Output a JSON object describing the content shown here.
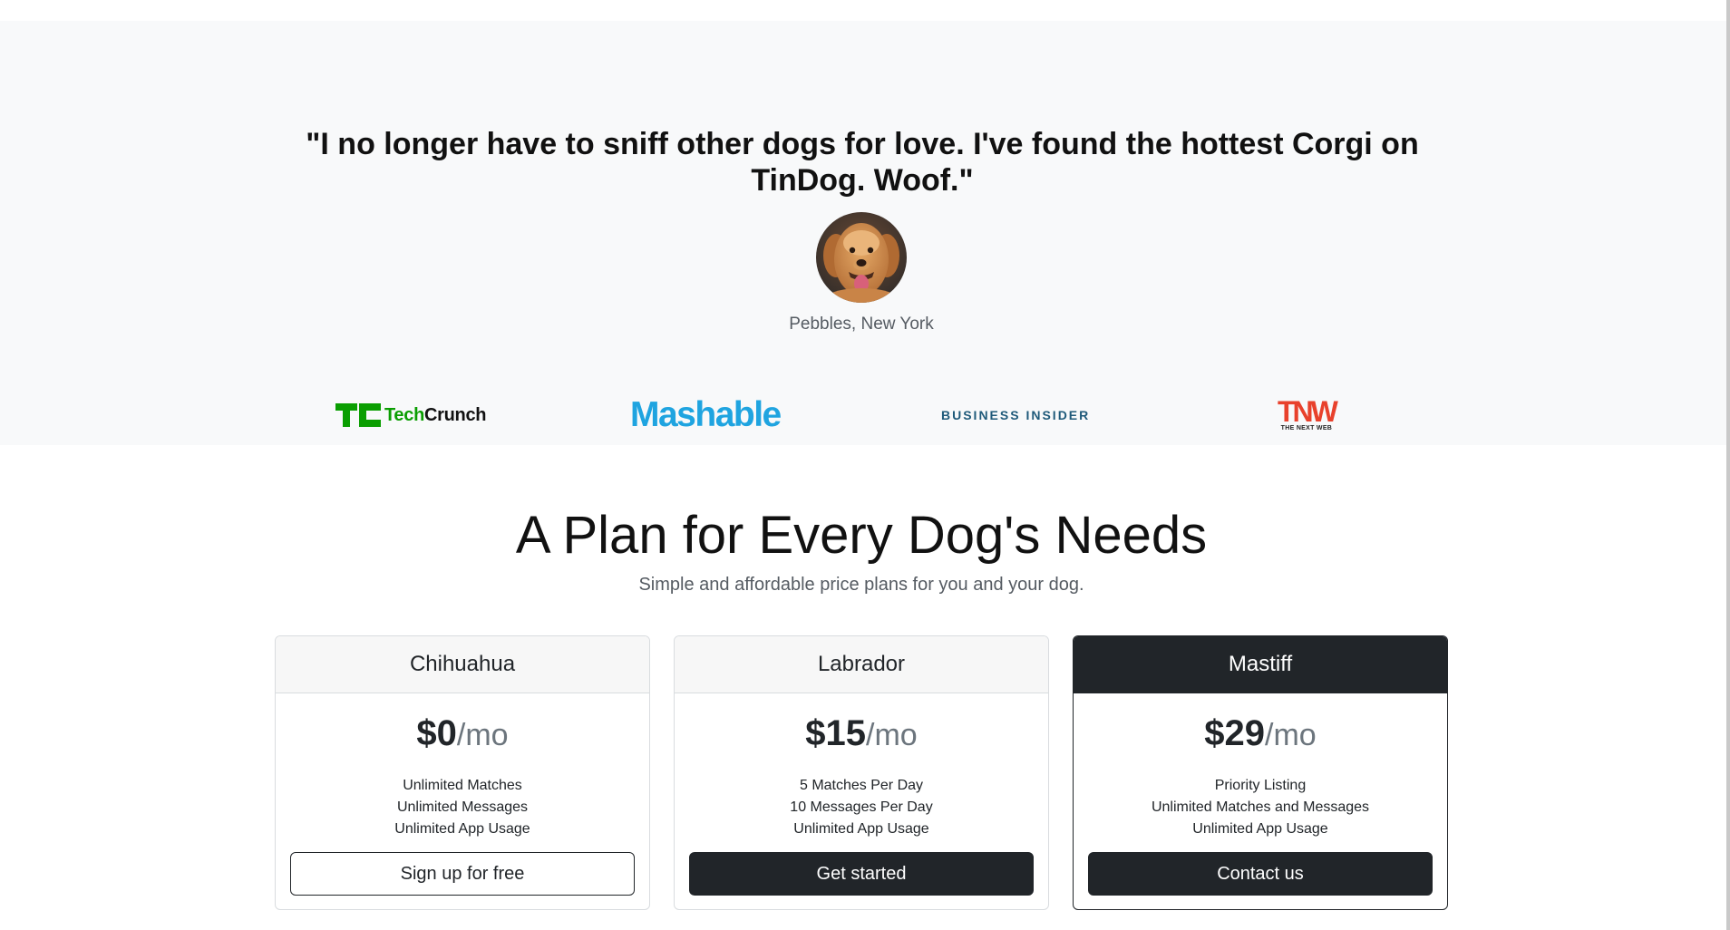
{
  "testimonial": {
    "quote": "\"I no longer have to sniff other dogs for love. I've found the hottest Corgi on TinDog. Woof.\"",
    "author": "Pebbles, New York",
    "avatar": "golden-retriever-photo"
  },
  "press": {
    "techcrunch": {
      "tech": "Tech",
      "crunch": "Crunch"
    },
    "mashable": "Mashable",
    "business_insider": "BUSINESS INSIDER",
    "tnw": {
      "mark": "TNW",
      "sub": "THE NEXT WEB"
    }
  },
  "pricing": {
    "title": "A Plan for Every Dog's Needs",
    "subtitle": "Simple and affordable price plans for you and your dog.",
    "plans": [
      {
        "name": "Chihuahua",
        "price": "$0",
        "period": "/mo",
        "features": [
          "Unlimited Matches",
          "Unlimited Messages",
          "Unlimited App Usage"
        ],
        "button": "Sign up for free"
      },
      {
        "name": "Labrador",
        "price": "$15",
        "period": "/mo",
        "features": [
          "5 Matches Per Day",
          "10 Messages Per Day",
          "Unlimited App Usage"
        ],
        "button": "Get started"
      },
      {
        "name": "Mastiff",
        "price": "$29",
        "period": "/mo",
        "features": [
          "Priority Listing",
          "Unlimited Matches and Messages",
          "Unlimited App Usage"
        ],
        "button": "Contact us"
      }
    ]
  },
  "colors": {
    "section_bg": "#f8f9fa",
    "dark": "#212529",
    "techcrunch_green": "#0a9e01",
    "mashable_blue": "#1fa4e0",
    "business_insider_blue": "#1f5a7a",
    "tnw_red": "#e8412c"
  }
}
